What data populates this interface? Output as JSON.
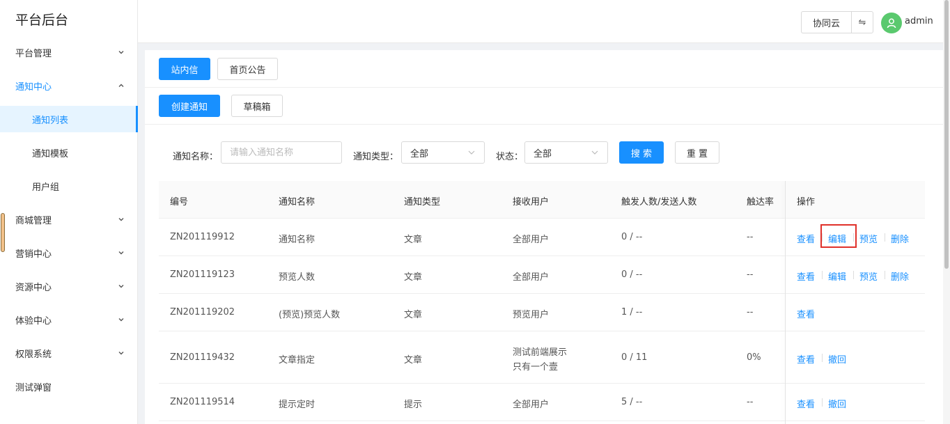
{
  "sidebar": {
    "brand": "平台后台",
    "menu": [
      {
        "label": "平台管理"
      },
      {
        "label": "通知中心"
      },
      {
        "label": "商城管理"
      },
      {
        "label": "营销中心"
      },
      {
        "label": "资源中心"
      },
      {
        "label": "体验中心"
      },
      {
        "label": "权限系统"
      },
      {
        "label": "测试弹窗"
      }
    ],
    "submenu": [
      {
        "label": "通知列表",
        "active": true
      },
      {
        "label": "通知模板"
      },
      {
        "label": "用户组"
      }
    ]
  },
  "header": {
    "workspace_button": "协同云",
    "swap_glyph": "⇋",
    "username": "admin"
  },
  "tabs": {
    "site_message": "站内信",
    "home_notice": "首页公告"
  },
  "actions": {
    "create": "创建通知",
    "drafts": "草稿箱"
  },
  "filters": {
    "name_label": "通知名称：",
    "name_placeholder": "请输入通知名称",
    "type_label": "通知类型：",
    "type_value": "全部",
    "status_label": "状态：",
    "status_value": "全部",
    "search": "搜 索",
    "reset": "重 置"
  },
  "table": {
    "columns": [
      "编号",
      "通知名称",
      "通知类型",
      "接收用户",
      "触发人数/发送人数",
      "触达率",
      "操作"
    ],
    "rows": [
      {
        "id": "ZN201119912",
        "name": "通知名称",
        "type": "文章",
        "receiver": "全部用户",
        "receiver2": "",
        "count": "0 / --",
        "rate": "--",
        "ops": [
          "查看",
          "编辑",
          "预览",
          "删除"
        ]
      },
      {
        "id": "ZN201119123",
        "name": "预览人数",
        "type": "文章",
        "receiver": "全部用户",
        "receiver2": "",
        "count": "0 / --",
        "rate": "--",
        "ops": [
          "查看",
          "编辑",
          "预览",
          "删除"
        ]
      },
      {
        "id": "ZN201119202",
        "name": "(预览)预览人数",
        "type": "文章",
        "receiver": "预览用户",
        "receiver2": "",
        "count": "1 / --",
        "rate": "--",
        "ops": [
          "查看"
        ]
      },
      {
        "id": "ZN201119432",
        "name": "文章指定",
        "type": "文章",
        "receiver": "测试前端展示",
        "receiver2": "只有一个壹",
        "count": "0 / 11",
        "rate": "0%",
        "ops": [
          "查看",
          "撤回"
        ]
      },
      {
        "id": "ZN201119514",
        "name": "提示定时",
        "type": "提示",
        "receiver": "全部用户",
        "receiver2": "",
        "count": "5 / --",
        "rate": "--",
        "ops": [
          "查看",
          "撤回"
        ]
      }
    ]
  },
  "colors": {
    "primary": "#1890ff",
    "highlight": "#e0302a",
    "avatar": "#5ac96e"
  }
}
